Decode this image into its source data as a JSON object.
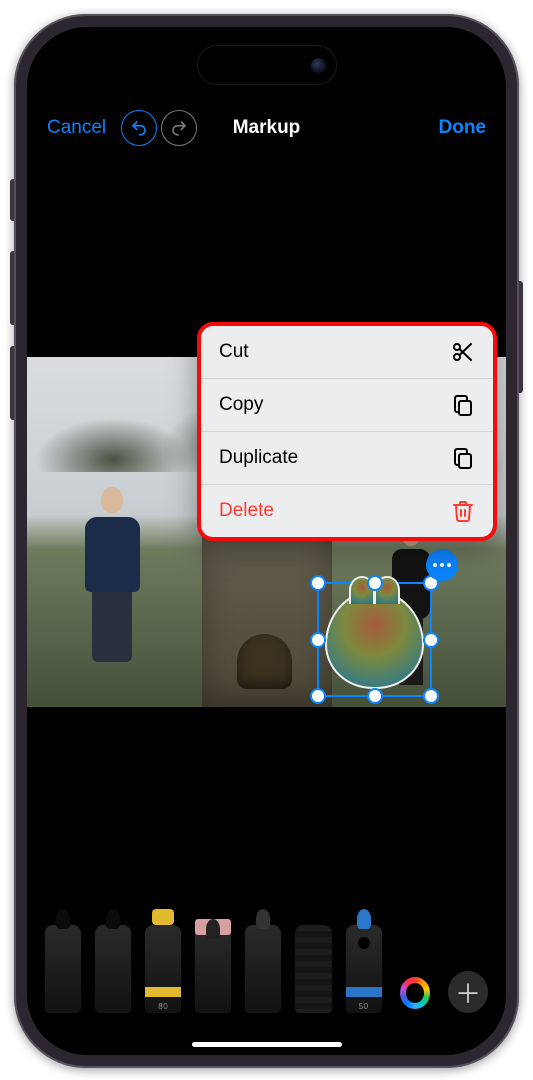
{
  "nav": {
    "cancel": "Cancel",
    "title": "Markup",
    "done": "Done"
  },
  "context_menu": {
    "items": [
      {
        "label": "Cut",
        "icon": "scissors-icon",
        "destructive": false
      },
      {
        "label": "Copy",
        "icon": "copy-icon",
        "destructive": false
      },
      {
        "label": "Duplicate",
        "icon": "copy-icon",
        "destructive": false
      },
      {
        "label": "Delete",
        "icon": "trash-icon",
        "destructive": true
      }
    ]
  },
  "tools": {
    "marker_value": "80",
    "blue_value": "50"
  },
  "colors": {
    "accent": "#0b84ff",
    "destructive": "#ff3b30",
    "highlight_border": "#f30c0c"
  }
}
